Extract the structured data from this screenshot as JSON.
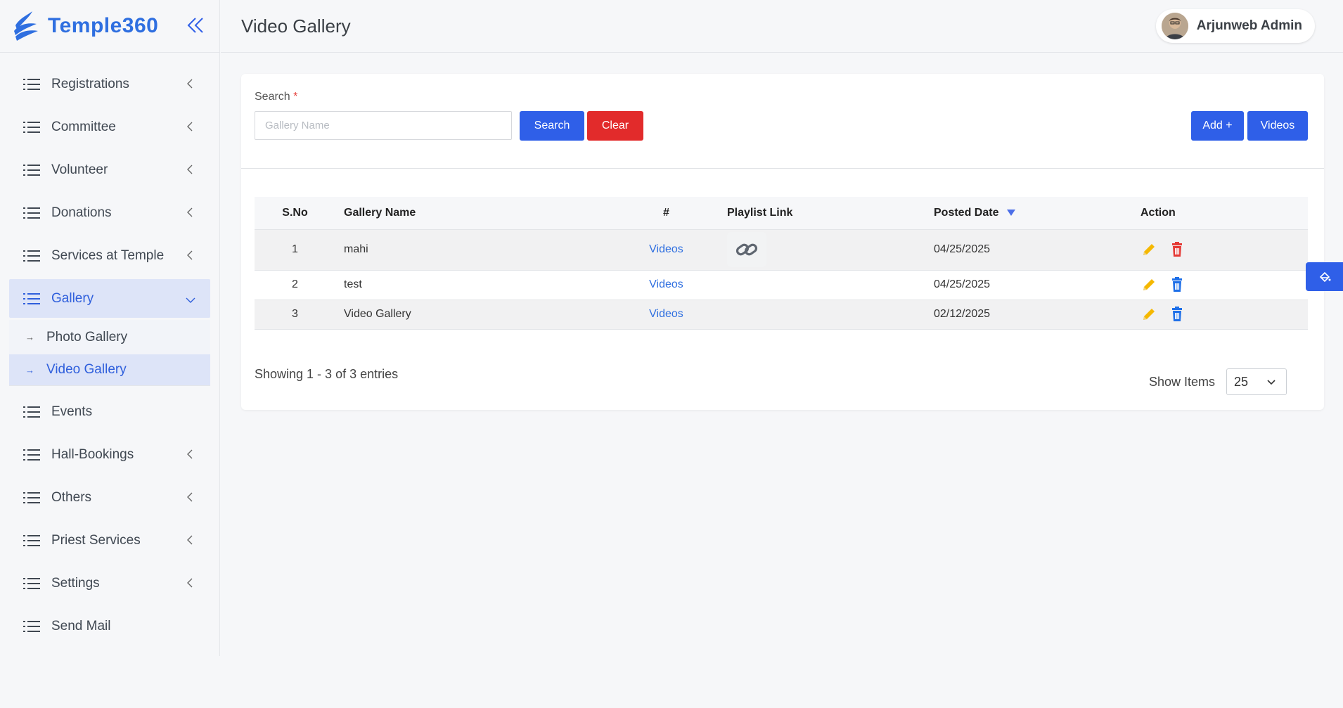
{
  "brand": {
    "name": "Temple360"
  },
  "header": {
    "title": "Video Gallery",
    "user_name": "Arjunweb Admin"
  },
  "sidebar": {
    "items": [
      {
        "label": "Registrations",
        "has_chevron": true
      },
      {
        "label": "Committee",
        "has_chevron": true
      },
      {
        "label": "Volunteer",
        "has_chevron": true
      },
      {
        "label": "Donations",
        "has_chevron": true
      },
      {
        "label": "Services at Temple",
        "has_chevron": true
      },
      {
        "label": "Gallery",
        "has_chevron": true,
        "active": true,
        "expanded": true
      },
      {
        "label": "Events",
        "has_chevron": false
      },
      {
        "label": "Hall-Bookings",
        "has_chevron": true
      },
      {
        "label": "Others",
        "has_chevron": true
      },
      {
        "label": "Priest Services",
        "has_chevron": true
      },
      {
        "label": "Settings",
        "has_chevron": true
      },
      {
        "label": "Send Mail",
        "has_chevron": false
      }
    ],
    "gallery_sub": [
      {
        "label": "Photo Gallery"
      },
      {
        "label": "Video Gallery",
        "active": true
      }
    ]
  },
  "search": {
    "label": "Search",
    "required_mark": "*",
    "placeholder": "Gallery Name",
    "value": "",
    "search_label": "Search",
    "clear_label": "Clear"
  },
  "toolbar": {
    "add_label": "Add +",
    "videos_label": "Videos"
  },
  "table": {
    "headers": {
      "sno": "S.No",
      "name": "Gallery Name",
      "hash": "#",
      "playlist": "Playlist Link",
      "date": "Posted Date",
      "action": "Action"
    },
    "rows": [
      {
        "sno": "1",
        "name": "mahi",
        "link": "Videos",
        "has_playlist": true,
        "date": "04/25/2025",
        "delete_color": "#e53935"
      },
      {
        "sno": "2",
        "name": "test",
        "link": "Videos",
        "has_playlist": false,
        "date": "04/25/2025",
        "delete_color": "#1e6fe8"
      },
      {
        "sno": "3",
        "name": "Video Gallery",
        "link": "Videos",
        "has_playlist": false,
        "date": "02/12/2025",
        "delete_color": "#1e6fe8"
      }
    ]
  },
  "footer": {
    "showing": "Showing 1 - 3 of 3 entries",
    "show_items_label": "Show Items",
    "page_size": "25"
  },
  "colors": {
    "accent": "#2f5fe8",
    "danger": "#e22b2b",
    "edit": "#f5b800"
  }
}
